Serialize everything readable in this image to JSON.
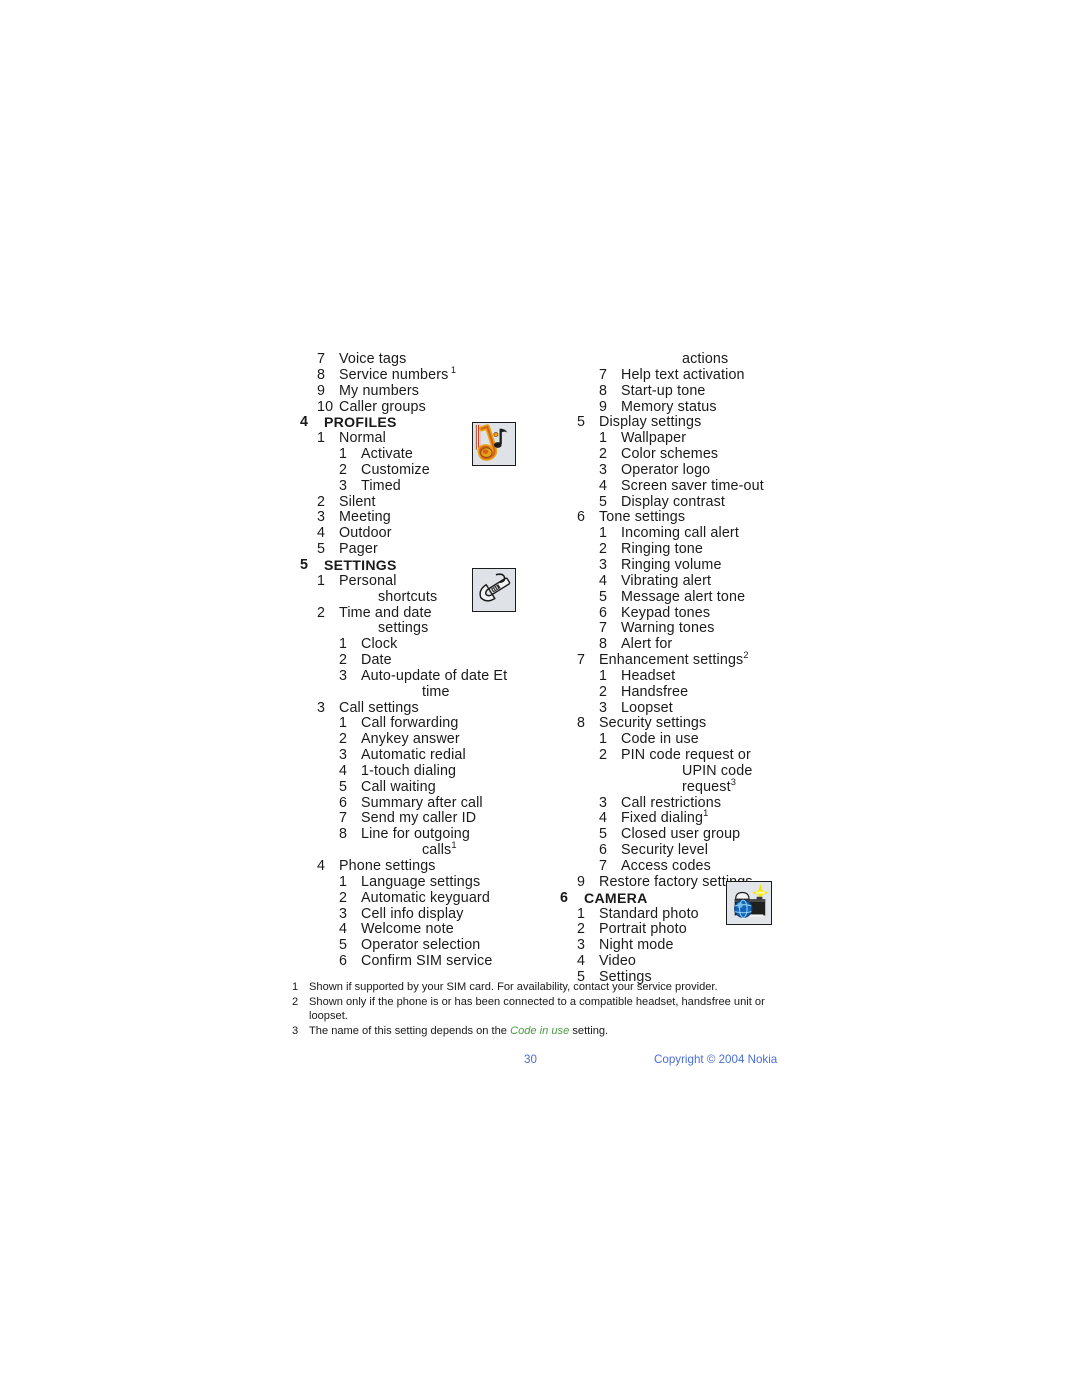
{
  "document": {
    "page_number": "30",
    "copyright": "Copyright © 2004 Nokia",
    "footer_color": "#4a6fd4"
  },
  "left_column": [
    {
      "level": 1,
      "num": "7",
      "label": "Voice tags"
    },
    {
      "level": 1,
      "num": "8",
      "label": "Service numbers",
      "sup": "1",
      "sup_spaced": true
    },
    {
      "level": 1,
      "num": "9",
      "label": "My numbers"
    },
    {
      "level": 1,
      "num": "10",
      "label": "Caller groups"
    },
    {
      "level": 0,
      "num": "4",
      "label": "PROFILES",
      "heading": true
    },
    {
      "level": 1,
      "num": "1",
      "label": "Normal"
    },
    {
      "level": 2,
      "num": "1",
      "label": "Activate"
    },
    {
      "level": 2,
      "num": "2",
      "label": "Customize"
    },
    {
      "level": 2,
      "num": "3",
      "label": "Timed"
    },
    {
      "level": 1,
      "num": "2",
      "label": "Silent"
    },
    {
      "level": 1,
      "num": "3",
      "label": "Meeting"
    },
    {
      "level": 1,
      "num": "4",
      "label": "Outdoor"
    },
    {
      "level": 1,
      "num": "5",
      "label": "Pager"
    },
    {
      "level": 0,
      "num": "5",
      "label": "SETTINGS",
      "heading": true
    },
    {
      "level": 1,
      "num": "1",
      "label": "Personal"
    },
    {
      "level": 1,
      "cont": true,
      "label": "shortcuts"
    },
    {
      "level": 1,
      "num": "2",
      "label": "Time and date"
    },
    {
      "level": 1,
      "cont": true,
      "label": "settings"
    },
    {
      "level": 2,
      "num": "1",
      "label": "Clock"
    },
    {
      "level": 2,
      "num": "2",
      "label": "Date"
    },
    {
      "level": 2,
      "num": "3",
      "label": "Auto-update of date Et"
    },
    {
      "level": 2,
      "cont": true,
      "label": "time"
    },
    {
      "level": 1,
      "num": "3",
      "label": "Call settings"
    },
    {
      "level": 2,
      "num": "1",
      "label": "Call forwarding"
    },
    {
      "level": 2,
      "num": "2",
      "label": "Anykey answer"
    },
    {
      "level": 2,
      "num": "3",
      "label": "Automatic redial"
    },
    {
      "level": 2,
      "num": "4",
      "label": "1-touch dialing"
    },
    {
      "level": 2,
      "num": "5",
      "label": "Call waiting"
    },
    {
      "level": 2,
      "num": "6",
      "label": "Summary after call"
    },
    {
      "level": 2,
      "num": "7",
      "label": "Send my caller ID"
    },
    {
      "level": 2,
      "num": "8",
      "label": "Line for outgoing"
    },
    {
      "level": 2,
      "cont": true,
      "label": "calls",
      "sup": "1"
    },
    {
      "level": 1,
      "num": "4",
      "label": "Phone settings"
    },
    {
      "level": 2,
      "num": "1",
      "label": "Language settings"
    },
    {
      "level": 2,
      "num": "2",
      "label": "Automatic keyguard"
    },
    {
      "level": 2,
      "num": "3",
      "label": "Cell info display"
    },
    {
      "level": 2,
      "num": "4",
      "label": "Welcome note"
    },
    {
      "level": 2,
      "num": "5",
      "label": "Operator selection"
    },
    {
      "level": 2,
      "num": "6",
      "label": "Confirm SIM service"
    }
  ],
  "right_column": [
    {
      "level": 2,
      "cont": true,
      "label": "actions"
    },
    {
      "level": 2,
      "num": "7",
      "label": "Help text activation"
    },
    {
      "level": 2,
      "num": "8",
      "label": "Start-up tone"
    },
    {
      "level": 2,
      "num": "9",
      "label": "Memory status"
    },
    {
      "level": 1,
      "num": "5",
      "label": "Display settings"
    },
    {
      "level": 2,
      "num": "1",
      "label": "Wallpaper"
    },
    {
      "level": 2,
      "num": "2",
      "label": "Color schemes"
    },
    {
      "level": 2,
      "num": "3",
      "label": "Operator logo"
    },
    {
      "level": 2,
      "num": "4",
      "label": "Screen saver time-out"
    },
    {
      "level": 2,
      "num": "5",
      "label": "Display contrast"
    },
    {
      "level": 1,
      "num": "6",
      "label": "Tone settings"
    },
    {
      "level": 2,
      "num": "1",
      "label": "Incoming call alert"
    },
    {
      "level": 2,
      "num": "2",
      "label": "Ringing tone"
    },
    {
      "level": 2,
      "num": "3",
      "label": "Ringing volume"
    },
    {
      "level": 2,
      "num": "4",
      "label": "Vibrating alert"
    },
    {
      "level": 2,
      "num": "5",
      "label": "Message alert tone"
    },
    {
      "level": 2,
      "num": "6",
      "label": "Keypad tones"
    },
    {
      "level": 2,
      "num": "7",
      "label": "Warning tones"
    },
    {
      "level": 2,
      "num": "8",
      "label": "Alert for"
    },
    {
      "level": 1,
      "num": "7",
      "label": "Enhancement settings",
      "sup": "2"
    },
    {
      "level": 2,
      "num": "1",
      "label": "Headset"
    },
    {
      "level": 2,
      "num": "2",
      "label": "Handsfree"
    },
    {
      "level": 2,
      "num": "3",
      "label": "Loopset"
    },
    {
      "level": 1,
      "num": "8",
      "label": "Security settings"
    },
    {
      "level": 2,
      "num": "1",
      "label": "Code in use"
    },
    {
      "level": 2,
      "num": "2",
      "label": "PIN code request or"
    },
    {
      "level": 2,
      "cont": true,
      "label": "UPIN code request",
      "sup": "3"
    },
    {
      "level": 2,
      "num": "3",
      "label": "Call restrictions"
    },
    {
      "level": 2,
      "num": "4",
      "label": "Fixed dialing",
      "sup": "1"
    },
    {
      "level": 2,
      "num": "5",
      "label": "Closed user group"
    },
    {
      "level": 2,
      "num": "6",
      "label": "Security level"
    },
    {
      "level": 2,
      "num": "7",
      "label": "Access codes"
    },
    {
      "level": 1,
      "num": "9",
      "label": "Restore factory settings"
    },
    {
      "level": 0,
      "num": "6",
      "label": "CAMERA",
      "heading": true
    },
    {
      "level": 1,
      "num": "1",
      "label": "Standard photo"
    },
    {
      "level": 1,
      "num": "2",
      "label": "Portrait photo"
    },
    {
      "level": 1,
      "num": "3",
      "label": "Night mode"
    },
    {
      "level": 1,
      "num": "4",
      "label": "Video"
    },
    {
      "level": 1,
      "num": "5",
      "label": "Settings"
    }
  ],
  "footnotes": [
    {
      "num": "1",
      "parts": [
        {
          "text": "Shown if supported by your SIM card. For availability, contact your service provider.",
          "style": "normal"
        }
      ]
    },
    {
      "num": "2",
      "parts": [
        {
          "text": "Shown only if the phone is or has been connected to a compatible headset, handsfree unit or loopset.",
          "style": "normal"
        }
      ]
    },
    {
      "num": "3",
      "parts": [
        {
          "text": "The name of this setting depends on the ",
          "style": "normal"
        },
        {
          "text": "Code in use",
          "style": "italic-green"
        },
        {
          "text": " setting.",
          "style": "normal"
        }
      ]
    }
  ],
  "icons": [
    {
      "name": "profiles-icon",
      "depicts": "saxophone-with-music-note"
    },
    {
      "name": "settings-icon",
      "depicts": "wrench"
    },
    {
      "name": "camera-icon",
      "depicts": "camera-with-flash-and-globe-lens"
    }
  ]
}
